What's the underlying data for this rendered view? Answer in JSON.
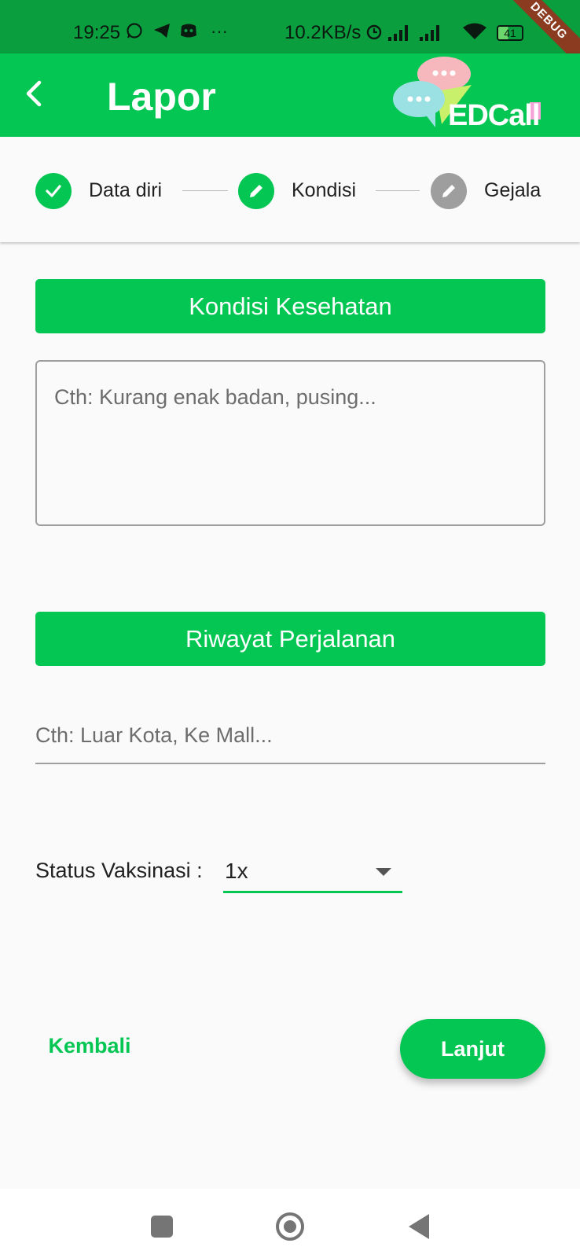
{
  "status_bar": {
    "time": "19:25",
    "net_speed": "10.2KB/s",
    "battery": "41",
    "more": "···",
    "debug_banner": "DEBUG"
  },
  "app_bar": {
    "title": "Lapor",
    "logo_text": "EDCall"
  },
  "stepper": {
    "steps": [
      {
        "label": "Data diri",
        "state": "completed",
        "icon": "check-icon"
      },
      {
        "label": "Kondisi",
        "state": "active",
        "icon": "pencil-icon"
      },
      {
        "label": "Gejala",
        "state": "inactive",
        "icon": "pencil-icon"
      }
    ]
  },
  "form": {
    "health": {
      "header": "Kondisi Kesehatan",
      "placeholder": "Cth: Kurang enak badan, pusing..."
    },
    "travel": {
      "header": "Riwayat Perjalanan",
      "placeholder": "Cth: Luar Kota, Ke Mall..."
    },
    "vaccination": {
      "label": "Status Vaksinasi :",
      "value": "1x"
    }
  },
  "actions": {
    "back_label": "Kembali",
    "next_label": "Lanjut"
  },
  "colors": {
    "primary": "#04c653",
    "status_bar": "#0a9e3f",
    "inactive_step": "#9e9e9e"
  }
}
